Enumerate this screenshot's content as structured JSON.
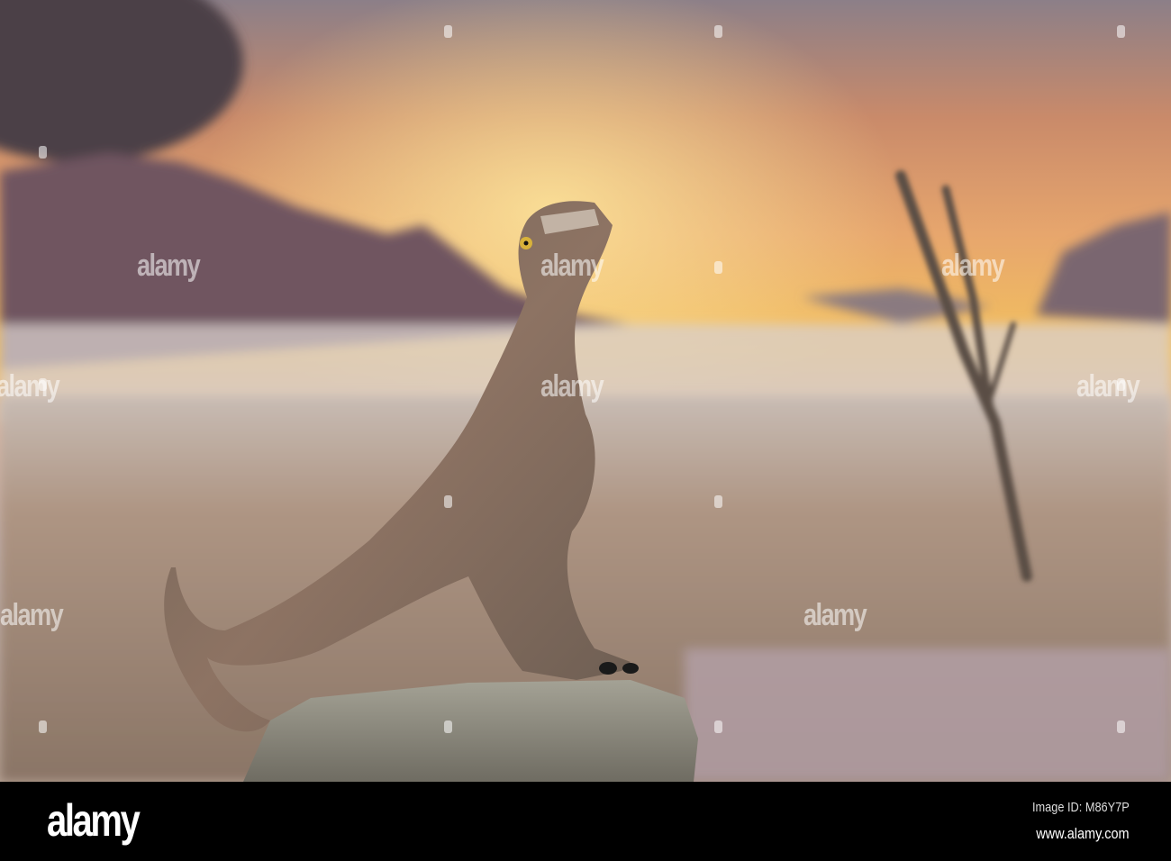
{
  "watermark": {
    "brand": "alamy"
  },
  "footer": {
    "logo": "alamy",
    "image_id": "Image ID: M86Y7P",
    "website": "www.alamy.com"
  },
  "colors": {
    "sky_top": "#8a7f86",
    "sunset": "#f1b04a",
    "ground": "#a99383",
    "dino": "#7a6a5c",
    "rock": "#8c8b80"
  }
}
